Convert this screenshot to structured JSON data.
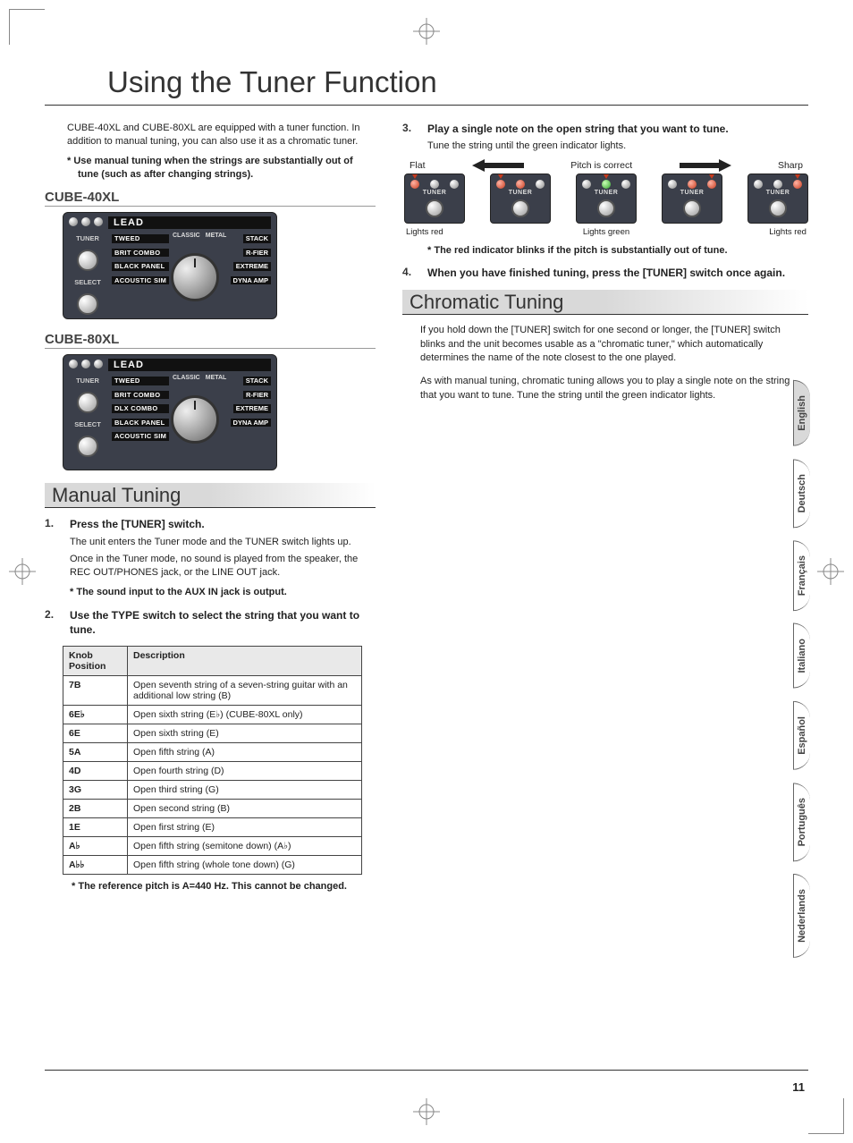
{
  "page_title": "Using the Tuner Function",
  "intro": "CUBE-40XL and CUBE-80XL are equipped with a tuner function. In addition to manual tuning, you can also use it as a chromatic tuner.",
  "intro_note": "Use manual tuning when the strings are substantially out of tune (such as after changing strings).",
  "device1_label": "CUBE-40XL",
  "device2_label": "CUBE-80XL",
  "panel": {
    "lead": "LEAD",
    "tuner": "TUNER",
    "select": "SELECT",
    "left40": [
      "TWEED",
      "BRIT COMBO",
      "BLACK PANEL",
      "ACOUSTIC SIM"
    ],
    "left80": [
      "TWEED",
      "BRIT COMBO",
      "DLX COMBO",
      "BLACK PANEL",
      "ACOUSTIC SIM"
    ],
    "top": [
      "CLASSIC",
      "STACK",
      "METAL"
    ],
    "right": [
      "R-FIER",
      "EXTREME",
      "DYNA AMP"
    ]
  },
  "manual_heading": "Manual Tuning",
  "steps": [
    {
      "head": "Press the [TUNER] switch.",
      "body": [
        "The unit enters the Tuner mode and the TUNER switch lights up.",
        "Once in the Tuner mode, no sound is played from the speaker, the REC OUT/PHONES jack, or the LINE OUT jack."
      ],
      "note": "The sound input to the AUX IN jack is output."
    },
    {
      "head": "Use the TYPE switch to select the string that you want to tune."
    },
    {
      "head": "Play a single note on the open string that you want to tune.",
      "body": [
        "Tune the string until the green indicator lights."
      ]
    },
    {
      "head": "When you have finished tuning, press the [TUNER] switch once again."
    }
  ],
  "step3_note": "The red indicator blinks if the pitch is substantially out of tune.",
  "table": {
    "headers": [
      "Knob Position",
      "Description"
    ],
    "rows": [
      [
        "7B",
        "Open seventh string of a seven-string guitar with an additional low string (B)"
      ],
      [
        "6E♭",
        "Open sixth string (E♭) (CUBE-80XL only)"
      ],
      [
        "6E",
        "Open sixth string (E)"
      ],
      [
        "5A",
        "Open fifth string (A)"
      ],
      [
        "4D",
        "Open fourth string (D)"
      ],
      [
        "3G",
        "Open third string (G)"
      ],
      [
        "2B",
        "Open second string (B)"
      ],
      [
        "1E",
        "Open first string (E)"
      ],
      [
        "A♭",
        "Open fifth string (semitone down) (A♭)"
      ],
      [
        "A♭♭",
        "Open fifth string (whole tone down) (G)"
      ]
    ],
    "note": "The reference pitch is A=440 Hz. This cannot be changed."
  },
  "tuner_strip": {
    "flat": "Flat",
    "correct": "Pitch is correct",
    "sharp": "Sharp",
    "tuner_label": "TUNER",
    "c_left": "Lights red",
    "c_mid": "Lights green",
    "c_right": "Lights red"
  },
  "chromatic_heading": "Chromatic Tuning",
  "chromatic_p1": "If you hold down the [TUNER] switch for one second or longer, the [TUNER] switch blinks and the unit becomes usable as a \"chromatic tuner,\" which automatically determines the name of the note closest to the one played.",
  "chromatic_p2": "As with manual tuning, chromatic tuning allows you to play a single note on the string that you want to tune. Tune the string until the green indicator lights.",
  "languages": [
    "English",
    "Deutsch",
    "Français",
    "Italiano",
    "Español",
    "Português",
    "Nederlands"
  ],
  "page_number": "11"
}
